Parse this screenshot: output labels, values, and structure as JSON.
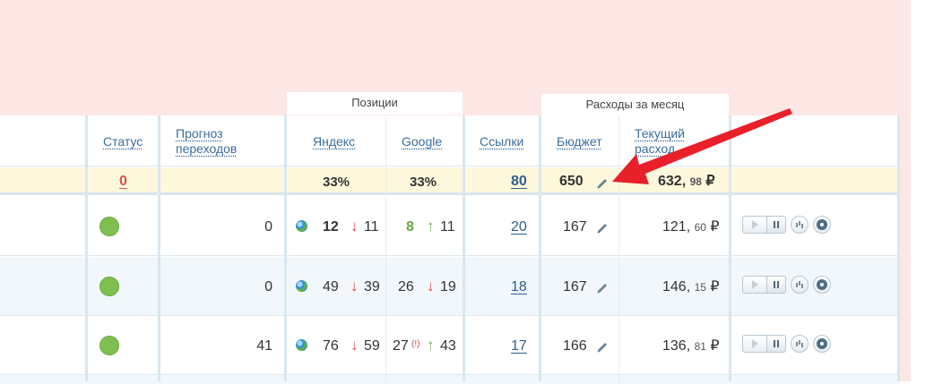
{
  "header": {
    "group_positions": "Позиции",
    "group_expenses": "Расходы за месяц",
    "col_status": "Статус",
    "col_forecast_1": "Прогноз",
    "col_forecast_2": "переходов",
    "col_yandex": "Яндекс",
    "col_google": "Google",
    "col_links": "Ссылки",
    "col_budget": "Бюджет",
    "col_current_1": "Текущий",
    "col_current_2": "расход"
  },
  "totals": {
    "status": "0",
    "yandex": "33%",
    "google": "33%",
    "links": "80",
    "budget": "650",
    "current_main": "632,",
    "current_kop": "98",
    "currency": "₽"
  },
  "rows": [
    {
      "forecast": "0",
      "yandex_pos": "12",
      "yandex_arrow": "↓",
      "yandex_prev": "11",
      "google_pos": "8",
      "google_warn": "",
      "google_arrow": "↑",
      "google_prev": "11",
      "links": "20",
      "budget": "167",
      "current_main": "121,",
      "current_kop": "60",
      "currency": "₽"
    },
    {
      "forecast": "0",
      "yandex_pos": "49",
      "yandex_arrow": "↓",
      "yandex_prev": "39",
      "google_pos": "26",
      "google_warn": "",
      "google_arrow": "↓",
      "google_prev": "19",
      "links": "18",
      "budget": "167",
      "current_main": "146,",
      "current_kop": "15",
      "currency": "₽"
    },
    {
      "forecast": "41",
      "yandex_pos": "76",
      "yandex_arrow": "↓",
      "yandex_prev": "59",
      "google_pos": "27",
      "google_warn": "(!)",
      "google_arrow": "↑",
      "google_prev": "43",
      "links": "17",
      "budget": "166",
      "current_main": "136,",
      "current_kop": "81",
      "currency": "₽"
    }
  ],
  "colors": {
    "background_pink": "#fde7e4",
    "status_green": "#7fbf50",
    "arrow_red": "#e0424a",
    "arrow_green": "#6db04a",
    "link_blue": "#3a6e9e",
    "totals_bg": "#fdf8dc",
    "annotation_arrow": "#e8202a"
  },
  "icons": {
    "edit": "pencil-icon",
    "play": "play-icon",
    "pause": "pause-icon",
    "stats": "bar-chart-icon",
    "settings": "gear-icon",
    "search_engine": "globe-icon"
  }
}
